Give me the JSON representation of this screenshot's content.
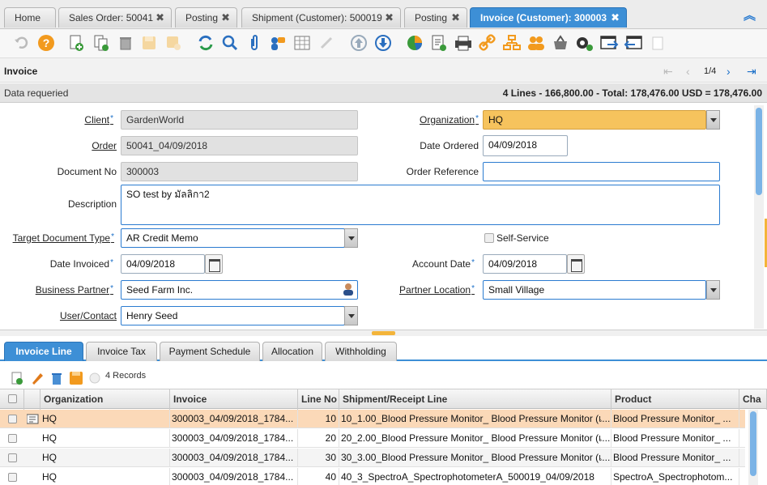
{
  "tabs": [
    {
      "label": "Home",
      "closable": false
    },
    {
      "label": "Sales Order: 50041",
      "closable": true
    },
    {
      "label": "Posting",
      "closable": true
    },
    {
      "label": "Shipment (Customer): 500019",
      "closable": true
    },
    {
      "label": "Posting",
      "closable": true
    },
    {
      "label": "Invoice (Customer): 300003",
      "closable": true,
      "active": true
    }
  ],
  "tab_close_glyph": "✖",
  "toolbar_icons": [
    "undo-icon",
    "help-icon",
    "new-record-icon",
    "copy-record-icon",
    "delete-icon",
    "save-icon",
    "save-new-icon",
    "refresh-icon",
    "find-icon",
    "attachment-icon",
    "chat-icon",
    "grid-toggle-icon",
    "translate-icon",
    "parent-record-icon",
    "detail-record-icon",
    "chart-icon",
    "report-icon",
    "print-icon",
    "zoom-across-icon",
    "workflow-icon",
    "requests-icon",
    "product-info-icon",
    "process-icon",
    "archive-icon",
    "post-icon",
    "lock-icon"
  ],
  "title": "Invoice",
  "pager": {
    "text": "1/4"
  },
  "status": {
    "message": "Data requeried",
    "summary": "4 Lines - 166,800.00 - Total: 178,476.00 USD = 178,476.00"
  },
  "form": {
    "client": {
      "label": "Client",
      "value": "GardenWorld"
    },
    "organization": {
      "label": "Organization",
      "value": "HQ"
    },
    "order": {
      "label": "Order",
      "value": "50041_04/09/2018"
    },
    "date_ordered": {
      "label": "Date Ordered",
      "value": "04/09/2018"
    },
    "document_no": {
      "label": "Document No",
      "value": "300003"
    },
    "order_reference": {
      "label": "Order Reference",
      "value": ""
    },
    "description": {
      "label": "Description",
      "value": "SO test by มัลลิกา2"
    },
    "target_doc_type": {
      "label": "Target Document Type",
      "value": "AR Credit Memo"
    },
    "self_service": {
      "label": "Self-Service"
    },
    "date_invoiced": {
      "label": "Date Invoiced",
      "value": "04/09/2018"
    },
    "account_date": {
      "label": "Account Date",
      "value": "04/09/2018"
    },
    "business_partner": {
      "label": "Business Partner",
      "value": "Seed Farm Inc."
    },
    "partner_location": {
      "label": "Partner Location",
      "value": "Small Village"
    },
    "user_contact": {
      "label": "User/Contact",
      "value": "Henry Seed"
    }
  },
  "required_mark": "*",
  "detail_tabs": [
    "Invoice Line",
    "Invoice Tax",
    "Payment Schedule",
    "Allocation",
    "Withholding"
  ],
  "grid": {
    "record_count": "4 Records",
    "columns": [
      "Organization",
      "Invoice",
      "Line No",
      "Shipment/Receipt Line",
      "Product",
      "Cha"
    ],
    "rows": [
      {
        "org": "HQ",
        "invoice": "300003_04/09/2018_1784...",
        "line": "10",
        "shipment": "10_1.00_Blood Pressure Monitor_ Blood Pressure Monitor (เ...",
        "product": "Blood Pressure Monitor_ ..."
      },
      {
        "org": "HQ",
        "invoice": "300003_04/09/2018_1784...",
        "line": "20",
        "shipment": "20_2.00_Blood Pressure Monitor_ Blood Pressure Monitor (เ...",
        "product": "Blood Pressure Monitor_ ..."
      },
      {
        "org": "HQ",
        "invoice": "300003_04/09/2018_1784...",
        "line": "30",
        "shipment": "30_3.00_Blood Pressure Monitor_ Blood Pressure Monitor (เ...",
        "product": "Blood Pressure Monitor_ ..."
      },
      {
        "org": "HQ",
        "invoice": "300003_04/09/2018_1784...",
        "line": "40",
        "shipment": "40_3_SpectroA_SpectrophotometerA_500019_04/09/2018",
        "product": "SpectroA_Spectrophotom..."
      }
    ]
  },
  "colors": {
    "accent": "#3d8fd6",
    "mandatory": "#f6c35d",
    "selected_row": "#fbd9b8"
  }
}
